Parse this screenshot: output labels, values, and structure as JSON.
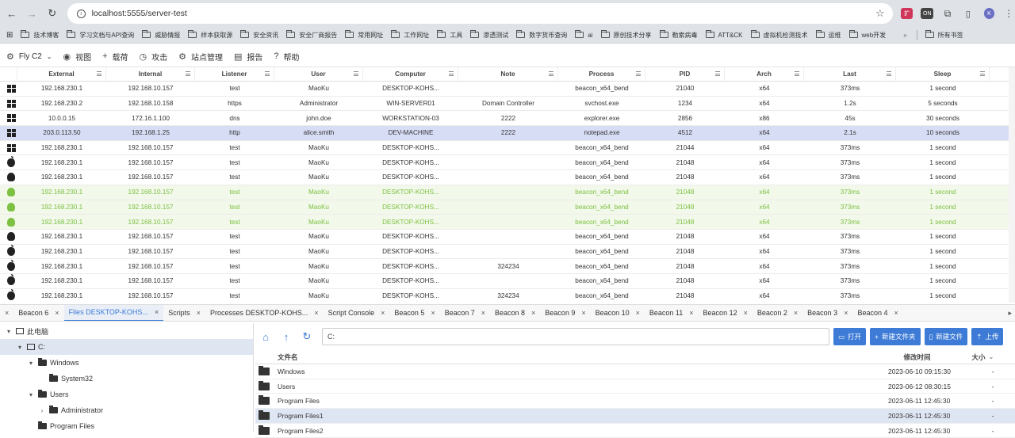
{
  "browser": {
    "url": "localhost:5555/server-test",
    "bookmarks": [
      "技术博客",
      "学习文档与API查询",
      "威胁情报",
      "样本获取源",
      "安全资讯",
      "安全厂商报告",
      "常用网址",
      "工作网址",
      "工具",
      "渗透测试",
      "数字货币查询",
      "ai",
      "原创技术分享",
      "勒索病毒",
      "ATT&CK",
      "虚拟机检测技术",
      "运维",
      "web开发"
    ],
    "all_bookmarks": "所有书签",
    "profile_initial": "K",
    "ext_label": "ON"
  },
  "menu": {
    "brand": "Fly C2",
    "items": [
      "视图",
      "载荷",
      "攻击",
      "站点管理",
      "报告",
      "帮助"
    ]
  },
  "table": {
    "columns": [
      "External",
      "Internal",
      "Listener",
      "User",
      "Computer",
      "Note",
      "Process",
      "PID",
      "Arch",
      "Last",
      "Sleep"
    ],
    "rows": [
      {
        "os": "windows",
        "style": "",
        "cells": [
          "192.168.230.1",
          "192.168.10.157",
          "test",
          "MaoKu",
          "DESKTOP-KOHS...",
          "",
          "beacon_x64_bend",
          "21040",
          "x64",
          "373ms",
          "1 second"
        ]
      },
      {
        "os": "windows",
        "style": "",
        "cells": [
          "192.168.230.2",
          "192.168.10.158",
          "https",
          "Administrator",
          "WIN-SERVER01",
          "Domain Controller",
          "svchost.exe",
          "1234",
          "x64",
          "1.2s",
          "5 seconds"
        ]
      },
      {
        "os": "windows",
        "style": "",
        "cells": [
          "10.0.0.15",
          "172.16.1.100",
          "dns",
          "john.doe",
          "WORKSTATION-03",
          "2222",
          "explorer.exe",
          "2856",
          "x86",
          "45s",
          "30 seconds"
        ]
      },
      {
        "os": "windows",
        "style": "sel",
        "cells": [
          "203.0.113.50",
          "192.168.1.25",
          "http",
          "alice.smith",
          "DEV-MACHINE",
          "2222",
          "notepad.exe",
          "4512",
          "x64",
          "2.1s",
          "10 seconds"
        ]
      },
      {
        "os": "windows",
        "style": "",
        "cells": [
          "192.168.230.1",
          "192.168.10.157",
          "test",
          "MaoKu",
          "DESKTOP-KOHS...",
          "",
          "beacon_x64_bend",
          "21044",
          "x64",
          "373ms",
          "1 second"
        ]
      },
      {
        "os": "apple",
        "style": "",
        "cells": [
          "192.168.230.1",
          "192.168.10.157",
          "test",
          "MaoKu",
          "DESKTOP-KOHS...",
          "",
          "beacon_x64_bend",
          "21048",
          "x64",
          "373ms",
          "1 second"
        ]
      },
      {
        "os": "linux",
        "style": "",
        "cells": [
          "192.168.230.1",
          "192.168.10.157",
          "test",
          "MaoKu",
          "DESKTOP-KOHS...",
          "",
          "beacon_x64_bend",
          "21048",
          "x64",
          "373ms",
          "1 second"
        ]
      },
      {
        "os": "linux-green",
        "style": "green",
        "cells": [
          "192.168.230.1",
          "192.168.10.157",
          "test",
          "MaoKu",
          "DESKTOP-KOHS...",
          "",
          "beacon_x64_bend",
          "21048",
          "x64",
          "373ms",
          "1 second"
        ]
      },
      {
        "os": "linux-green",
        "style": "green",
        "cells": [
          "192.168.230.1",
          "192.168.10.157",
          "test",
          "MaoKu",
          "DESKTOP-KOHS...",
          "",
          "beacon_x64_bend",
          "21048",
          "x64",
          "373ms",
          "1 second"
        ]
      },
      {
        "os": "linux-green",
        "style": "green",
        "cells": [
          "192.168.230.1",
          "192.168.10.157",
          "test",
          "MaoKu",
          "DESKTOP-KOHS...",
          "",
          "beacon_x64_bend",
          "21048",
          "x64",
          "373ms",
          "1 second"
        ]
      },
      {
        "os": "linux",
        "style": "",
        "cells": [
          "192.168.230.1",
          "192.168.10.157",
          "test",
          "MaoKu",
          "DESKTOP-KOHS...",
          "",
          "beacon_x64_bend",
          "21048",
          "x64",
          "373ms",
          "1 second"
        ]
      },
      {
        "os": "apple",
        "style": "",
        "cells": [
          "192.168.230.1",
          "192.168.10.157",
          "test",
          "MaoKu",
          "DESKTOP-KOHS...",
          "",
          "beacon_x64_bend",
          "21048",
          "x64",
          "373ms",
          "1 second"
        ]
      },
      {
        "os": "apple",
        "style": "",
        "cells": [
          "192.168.230.1",
          "192.168.10.157",
          "test",
          "MaoKu",
          "DESKTOP-KOHS...",
          "324234",
          "beacon_x64_bend",
          "21048",
          "x64",
          "373ms",
          "1 second"
        ]
      },
      {
        "os": "apple",
        "style": "",
        "cells": [
          "192.168.230.1",
          "192.168.10.157",
          "test",
          "MaoKu",
          "DESKTOP-KOHS...",
          "",
          "beacon_x64_bend",
          "21048",
          "x64",
          "373ms",
          "1 second"
        ]
      },
      {
        "os": "apple",
        "style": "",
        "cells": [
          "192.168.230.1",
          "192.168.10.157",
          "test",
          "MaoKu",
          "DESKTOP-KOHS...",
          "324234",
          "beacon_x64_bend",
          "21048",
          "x64",
          "373ms",
          "1 second"
        ]
      }
    ]
  },
  "tabs": [
    "Beacon 6",
    "Files DESKTOP-KOHS...",
    "Scripts",
    "Processes DESKTOP-KOHS...",
    "Script Console",
    "Beacon 5",
    "Beacon 7",
    "Beacon 8",
    "Beacon 9",
    "Beacon 10",
    "Beacon 11",
    "Beacon 12",
    "Beacon 2",
    "Beacon 3",
    "Beacon 4"
  ],
  "active_tab": 1,
  "tree": [
    {
      "label": "此电脑",
      "kind": "pc",
      "level": 0,
      "arrow": "▾",
      "sel": false
    },
    {
      "label": "C:",
      "kind": "drive",
      "level": 1,
      "arrow": "▾",
      "sel": true
    },
    {
      "label": "Windows",
      "kind": "folder",
      "level": 2,
      "arrow": "▾",
      "sel": false
    },
    {
      "label": "System32",
      "kind": "folder",
      "level": 3,
      "arrow": "",
      "sel": false
    },
    {
      "label": "Users",
      "kind": "folder",
      "level": 2,
      "arrow": "▾",
      "sel": false
    },
    {
      "label": "Administrator",
      "kind": "folder",
      "level": 3,
      "arrow": "›",
      "sel": false
    },
    {
      "label": "Program Files",
      "kind": "folder",
      "level": 2,
      "arrow": "",
      "sel": false
    }
  ],
  "files": {
    "path": "C:",
    "buttons": [
      "打开",
      "新建文件夹",
      "新建文件",
      "上传"
    ],
    "headers": {
      "name": "文件名",
      "modified": "修改时间",
      "size": "大小"
    },
    "rows": [
      {
        "name": "Windows",
        "modified": "2023-06-10 09:15:30",
        "size": "-",
        "sel": false
      },
      {
        "name": "Users",
        "modified": "2023-06-12 08:30:15",
        "size": "-",
        "sel": false
      },
      {
        "name": "Program Files",
        "modified": "2023-06-11 12:45:30",
        "size": "-",
        "sel": false
      },
      {
        "name": "Program Files1",
        "modified": "2023-06-11 12:45:30",
        "size": "-",
        "sel": true
      },
      {
        "name": "Program Files2",
        "modified": "2023-06-11 12:45:30",
        "size": "-",
        "sel": false
      }
    ]
  }
}
